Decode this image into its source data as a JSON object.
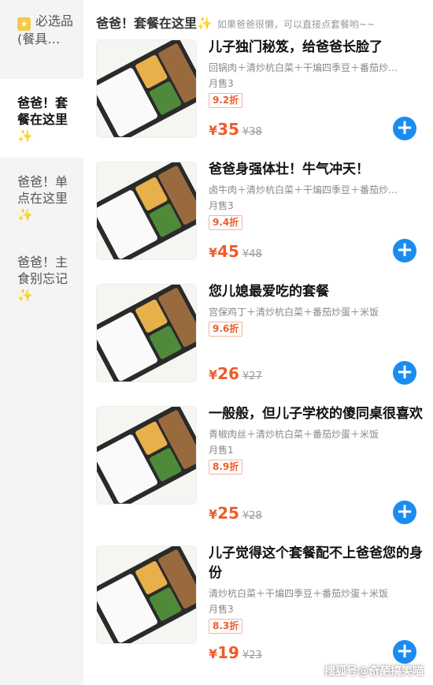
{
  "header": {
    "title": "爸爸！套餐在这里",
    "sparkle": "✨",
    "subtitle": "如果爸爸很懒，可以直接点套餐哟~~"
  },
  "sidebar": {
    "items": [
      {
        "label": "必选品(餐具…",
        "icon": "star-icon",
        "sparkle": ""
      },
      {
        "label": "爸爸！套餐在这里",
        "sparkle": "✨"
      },
      {
        "label": "爸爸！单点在这里",
        "sparkle": "✨"
      },
      {
        "label": "爸爸！主食别忘记",
        "sparkle": "✨"
      }
    ]
  },
  "products": [
    {
      "name": "儿子独门秘笈，给爸爸长脸了",
      "desc": "回锅肉＋清炒杭白菜＋干煸四季豆＋番茄炒…",
      "sales": "月售3",
      "discount": "9.2折",
      "price": "35",
      "original_price": "¥38"
    },
    {
      "name": "爸爸身强体壮！牛气冲天！",
      "desc": "卤牛肉＋清炒杭白菜＋干煸四季豆＋番茄炒…",
      "sales": "月售3",
      "discount": "9.4折",
      "price": "45",
      "original_price": "¥48"
    },
    {
      "name": "您儿媳最爱吃的套餐",
      "desc": "宫保鸡丁＋清炒杭白菜＋番茄炒蛋＋米饭",
      "sales": "",
      "discount": "9.6折",
      "price": "26",
      "original_price": "¥27"
    },
    {
      "name": "一般般，但儿子学校的傻同桌很喜欢",
      "desc": "青椒肉丝＋清炒杭白菜＋番茄炒蛋＋米饭",
      "sales": "月售1",
      "discount": "8.9折",
      "price": "25",
      "original_price": "¥28"
    },
    {
      "name": "儿子觉得这个套餐配不上爸爸您的身份",
      "desc": "清炒杭白菜＋干煸四季豆＋番茄炒蛋＋米饭",
      "sales": "月售3",
      "discount": "8.3折",
      "price": "19",
      "original_price": "¥23"
    }
  ],
  "currency": "¥",
  "add_symbol": "+",
  "watermark": "搜狐号@奇葩搞笑喵",
  "colors": {
    "accent_price": "#f05b28",
    "add_button": "#1a8cf0",
    "sidebar_bg": "#f4f4f4"
  }
}
